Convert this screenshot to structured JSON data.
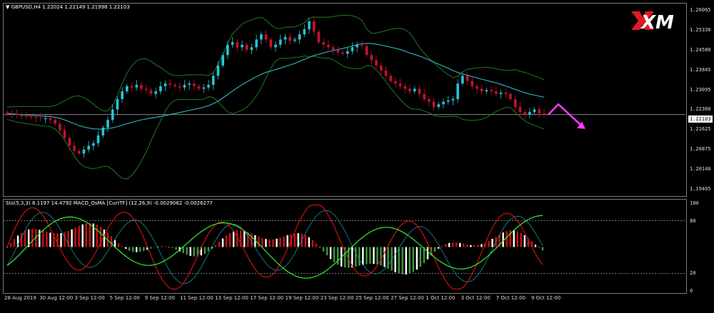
{
  "window": {
    "symbol_header": "GBPUSD,H4  1.22024 1.22149 1.21998 1.22103",
    "indicator_header": "Sto(5,3,3) 8.1197 14.4792  MACD_OsMA [CurrTF] (12,26,9) -0.0029062 -0.0026277",
    "current_price": "1.22103",
    "logo_text": "XM"
  },
  "price_scale": [
    "1.26065",
    "1.25330",
    "1.24580",
    "1.23845",
    "1.23095",
    "1.22360",
    "1.21625",
    "1.20875",
    "1.20140",
    "1.19405"
  ],
  "indicator_scale": [
    "100",
    "80",
    "20",
    "0"
  ],
  "time_axis": [
    "28 Aug 2019",
    "30 Aug 12:00",
    "3 Sep 12:00",
    "5 Sep 12:00",
    "9 Sep 12:00",
    "11 Sep 12:00",
    "13 Sep 12:00",
    "17 Sep 12:00",
    "19 Sep 12:00",
    "23 Sep 12:00",
    "25 Sep 12:00",
    "27 Sep 12:00",
    "1 Oct 12:00",
    "3 Oct 12:00",
    "7 Oct 12:00",
    "9 Oct 12:00"
  ],
  "colors": {
    "bull": "#22c7d9",
    "bear": "#c8102e",
    "band": "#1f7a1f",
    "ma": "#2fa7b5",
    "arrow": "#ff3cff",
    "stoch_main": "#cc1111",
    "stoch_signal": "#33ee33",
    "hist_pos_red": "#cc1111",
    "hist_pos_white": "#ffffff",
    "hist_neg_green": "#3c9a3c",
    "hist_neg_white": "#ffffff"
  },
  "chart_data": {
    "type": "candlestick",
    "symbol": "GBPUSD",
    "timeframe": "H4",
    "ohlc_header": {
      "open": 1.22024,
      "high": 1.22149,
      "low": 1.21998,
      "close": 1.22103
    },
    "ylim": [
      1.1915,
      1.2625
    ],
    "close_series": [
      1.2215,
      1.2212,
      1.2208,
      1.2205,
      1.2203,
      1.22,
      1.2198,
      1.2195,
      1.2196,
      1.219,
      1.2175,
      1.215,
      1.212,
      1.209,
      1.207,
      1.206,
      1.2075,
      1.209,
      1.21,
      1.213,
      1.216,
      1.219,
      1.223,
      1.227,
      1.23,
      1.232,
      1.2315,
      1.2325,
      1.231,
      1.2305,
      1.229,
      1.23,
      1.232,
      1.233,
      1.2325,
      1.232,
      1.2315,
      1.2325,
      1.233,
      1.232,
      1.231,
      1.2315,
      1.2325,
      1.236,
      1.24,
      1.244,
      1.248,
      1.249,
      1.247,
      1.248,
      1.246,
      1.247,
      1.25,
      1.252,
      1.25,
      1.247,
      1.248,
      1.25,
      1.251,
      1.2495,
      1.25,
      1.252,
      1.254,
      1.257,
      1.253,
      1.249,
      1.248,
      1.247,
      1.246,
      1.245,
      1.2445,
      1.2455,
      1.247,
      1.248,
      1.2475,
      1.244,
      1.242,
      1.24,
      1.238,
      1.236,
      1.234,
      1.233,
      1.232,
      1.231,
      1.23,
      1.231,
      1.229,
      1.227,
      1.226,
      1.224,
      1.225,
      1.226,
      1.2265,
      1.227,
      1.233,
      1.236,
      1.234,
      1.232,
      1.231,
      1.23,
      1.2305,
      1.23,
      1.229,
      1.2295,
      1.229,
      1.227,
      1.224,
      1.222,
      1.221,
      1.222,
      1.223,
      1.2215,
      1.221
    ],
    "forecast_arrow": {
      "up_to": 1.225,
      "down_to": 1.2155
    }
  },
  "indicator_data": {
    "type": "oscillator",
    "stochastic": {
      "k": 8.1197,
      "d": 14.4792,
      "params": "5,3,3"
    },
    "macd_osma": {
      "osma": -0.0029062,
      "signal": -0.0026277,
      "params": "12,26,9"
    },
    "ylim": [
      0,
      100
    ],
    "levels": [
      20,
      80
    ]
  }
}
